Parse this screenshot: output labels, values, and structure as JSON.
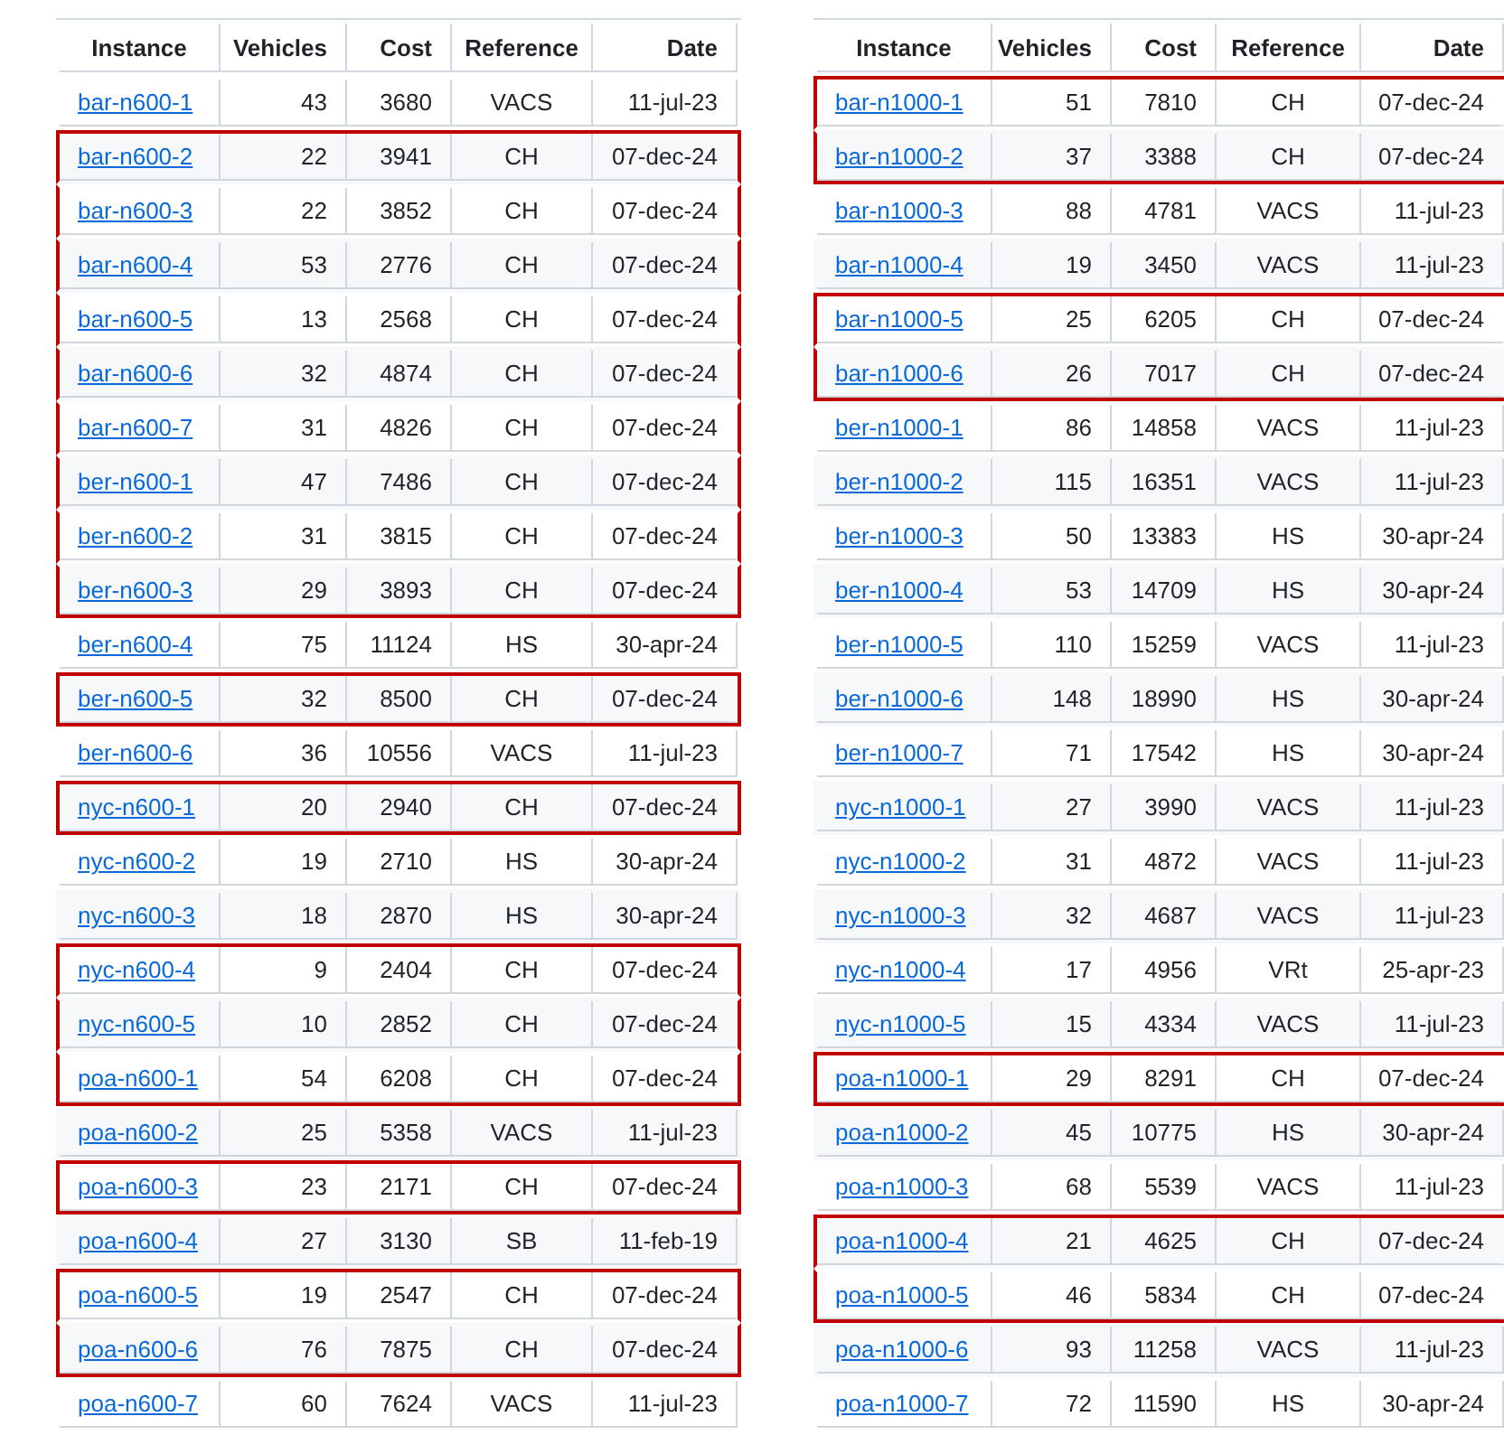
{
  "tables": [
    {
      "columns": [
        "Instance",
        "Vehicles",
        "Cost",
        "Reference",
        "Date"
      ],
      "rows": [
        {
          "instance": "bar-n600-1",
          "vehicles": "43",
          "cost": "3680",
          "reference": "VACS",
          "date": "11-jul-23",
          "highlighted": false
        },
        {
          "instance": "bar-n600-2",
          "vehicles": "22",
          "cost": "3941",
          "reference": "CH",
          "date": "07-dec-24",
          "highlighted": true
        },
        {
          "instance": "bar-n600-3",
          "vehicles": "22",
          "cost": "3852",
          "reference": "CH",
          "date": "07-dec-24",
          "highlighted": true
        },
        {
          "instance": "bar-n600-4",
          "vehicles": "53",
          "cost": "2776",
          "reference": "CH",
          "date": "07-dec-24",
          "highlighted": true
        },
        {
          "instance": "bar-n600-5",
          "vehicles": "13",
          "cost": "2568",
          "reference": "CH",
          "date": "07-dec-24",
          "highlighted": true
        },
        {
          "instance": "bar-n600-6",
          "vehicles": "32",
          "cost": "4874",
          "reference": "CH",
          "date": "07-dec-24",
          "highlighted": true
        },
        {
          "instance": "bar-n600-7",
          "vehicles": "31",
          "cost": "4826",
          "reference": "CH",
          "date": "07-dec-24",
          "highlighted": true
        },
        {
          "instance": "ber-n600-1",
          "vehicles": "47",
          "cost": "7486",
          "reference": "CH",
          "date": "07-dec-24",
          "highlighted": true
        },
        {
          "instance": "ber-n600-2",
          "vehicles": "31",
          "cost": "3815",
          "reference": "CH",
          "date": "07-dec-24",
          "highlighted": true
        },
        {
          "instance": "ber-n600-3",
          "vehicles": "29",
          "cost": "3893",
          "reference": "CH",
          "date": "07-dec-24",
          "highlighted": true
        },
        {
          "instance": "ber-n600-4",
          "vehicles": "75",
          "cost": "11124",
          "reference": "HS",
          "date": "30-apr-24",
          "highlighted": false
        },
        {
          "instance": "ber-n600-5",
          "vehicles": "32",
          "cost": "8500",
          "reference": "CH",
          "date": "07-dec-24",
          "highlighted": true
        },
        {
          "instance": "ber-n600-6",
          "vehicles": "36",
          "cost": "10556",
          "reference": "VACS",
          "date": "11-jul-23",
          "highlighted": false
        },
        {
          "instance": "nyc-n600-1",
          "vehicles": "20",
          "cost": "2940",
          "reference": "CH",
          "date": "07-dec-24",
          "highlighted": true
        },
        {
          "instance": "nyc-n600-2",
          "vehicles": "19",
          "cost": "2710",
          "reference": "HS",
          "date": "30-apr-24",
          "highlighted": false
        },
        {
          "instance": "nyc-n600-3",
          "vehicles": "18",
          "cost": "2870",
          "reference": "HS",
          "date": "30-apr-24",
          "highlighted": false
        },
        {
          "instance": "nyc-n600-4",
          "vehicles": "9",
          "cost": "2404",
          "reference": "CH",
          "date": "07-dec-24",
          "highlighted": true
        },
        {
          "instance": "nyc-n600-5",
          "vehicles": "10",
          "cost": "2852",
          "reference": "CH",
          "date": "07-dec-24",
          "highlighted": true
        },
        {
          "instance": "poa-n600-1",
          "vehicles": "54",
          "cost": "6208",
          "reference": "CH",
          "date": "07-dec-24",
          "highlighted": true
        },
        {
          "instance": "poa-n600-2",
          "vehicles": "25",
          "cost": "5358",
          "reference": "VACS",
          "date": "11-jul-23",
          "highlighted": false
        },
        {
          "instance": "poa-n600-3",
          "vehicles": "23",
          "cost": "2171",
          "reference": "CH",
          "date": "07-dec-24",
          "highlighted": true
        },
        {
          "instance": "poa-n600-4",
          "vehicles": "27",
          "cost": "3130",
          "reference": "SB",
          "date": "11-feb-19",
          "highlighted": false
        },
        {
          "instance": "poa-n600-5",
          "vehicles": "19",
          "cost": "2547",
          "reference": "CH",
          "date": "07-dec-24",
          "highlighted": true
        },
        {
          "instance": "poa-n600-6",
          "vehicles": "76",
          "cost": "7875",
          "reference": "CH",
          "date": "07-dec-24",
          "highlighted": true
        },
        {
          "instance": "poa-n600-7",
          "vehicles": "60",
          "cost": "7624",
          "reference": "VACS",
          "date": "11-jul-23",
          "highlighted": false
        }
      ]
    },
    {
      "columns": [
        "Instance",
        "Vehicles",
        "Cost",
        "Reference",
        "Date"
      ],
      "rows": [
        {
          "instance": "bar-n1000-1",
          "vehicles": "51",
          "cost": "7810",
          "reference": "CH",
          "date": "07-dec-24",
          "highlighted": true
        },
        {
          "instance": "bar-n1000-2",
          "vehicles": "37",
          "cost": "3388",
          "reference": "CH",
          "date": "07-dec-24",
          "highlighted": true
        },
        {
          "instance": "bar-n1000-3",
          "vehicles": "88",
          "cost": "4781",
          "reference": "VACS",
          "date": "11-jul-23",
          "highlighted": false
        },
        {
          "instance": "bar-n1000-4",
          "vehicles": "19",
          "cost": "3450",
          "reference": "VACS",
          "date": "11-jul-23",
          "highlighted": false
        },
        {
          "instance": "bar-n1000-5",
          "vehicles": "25",
          "cost": "6205",
          "reference": "CH",
          "date": "07-dec-24",
          "highlighted": true
        },
        {
          "instance": "bar-n1000-6",
          "vehicles": "26",
          "cost": "7017",
          "reference": "CH",
          "date": "07-dec-24",
          "highlighted": true
        },
        {
          "instance": "ber-n1000-1",
          "vehicles": "86",
          "cost": "14858",
          "reference": "VACS",
          "date": "11-jul-23",
          "highlighted": false
        },
        {
          "instance": "ber-n1000-2",
          "vehicles": "115",
          "cost": "16351",
          "reference": "VACS",
          "date": "11-jul-23",
          "highlighted": false
        },
        {
          "instance": "ber-n1000-3",
          "vehicles": "50",
          "cost": "13383",
          "reference": "HS",
          "date": "30-apr-24",
          "highlighted": false
        },
        {
          "instance": "ber-n1000-4",
          "vehicles": "53",
          "cost": "14709",
          "reference": "HS",
          "date": "30-apr-24",
          "highlighted": false
        },
        {
          "instance": "ber-n1000-5",
          "vehicles": "110",
          "cost": "15259",
          "reference": "VACS",
          "date": "11-jul-23",
          "highlighted": false
        },
        {
          "instance": "ber-n1000-6",
          "vehicles": "148",
          "cost": "18990",
          "reference": "HS",
          "date": "30-apr-24",
          "highlighted": false
        },
        {
          "instance": "ber-n1000-7",
          "vehicles": "71",
          "cost": "17542",
          "reference": "HS",
          "date": "30-apr-24",
          "highlighted": false
        },
        {
          "instance": "nyc-n1000-1",
          "vehicles": "27",
          "cost": "3990",
          "reference": "VACS",
          "date": "11-jul-23",
          "highlighted": false
        },
        {
          "instance": "nyc-n1000-2",
          "vehicles": "31",
          "cost": "4872",
          "reference": "VACS",
          "date": "11-jul-23",
          "highlighted": false
        },
        {
          "instance": "nyc-n1000-3",
          "vehicles": "32",
          "cost": "4687",
          "reference": "VACS",
          "date": "11-jul-23",
          "highlighted": false
        },
        {
          "instance": "nyc-n1000-4",
          "vehicles": "17",
          "cost": "4956",
          "reference": "VRt",
          "date": "25-apr-23",
          "highlighted": false
        },
        {
          "instance": "nyc-n1000-5",
          "vehicles": "15",
          "cost": "4334",
          "reference": "VACS",
          "date": "11-jul-23",
          "highlighted": false
        },
        {
          "instance": "poa-n1000-1",
          "vehicles": "29",
          "cost": "8291",
          "reference": "CH",
          "date": "07-dec-24",
          "highlighted": true
        },
        {
          "instance": "poa-n1000-2",
          "vehicles": "45",
          "cost": "10775",
          "reference": "HS",
          "date": "30-apr-24",
          "highlighted": false
        },
        {
          "instance": "poa-n1000-3",
          "vehicles": "68",
          "cost": "5539",
          "reference": "VACS",
          "date": "11-jul-23",
          "highlighted": false
        },
        {
          "instance": "poa-n1000-4",
          "vehicles": "21",
          "cost": "4625",
          "reference": "CH",
          "date": "07-dec-24",
          "highlighted": true
        },
        {
          "instance": "poa-n1000-5",
          "vehicles": "46",
          "cost": "5834",
          "reference": "CH",
          "date": "07-dec-24",
          "highlighted": true
        },
        {
          "instance": "poa-n1000-6",
          "vehicles": "93",
          "cost": "11258",
          "reference": "VACS",
          "date": "11-jul-23",
          "highlighted": false
        },
        {
          "instance": "poa-n1000-7",
          "vehicles": "72",
          "cost": "11590",
          "reference": "HS",
          "date": "30-apr-24",
          "highlighted": false
        }
      ]
    }
  ]
}
